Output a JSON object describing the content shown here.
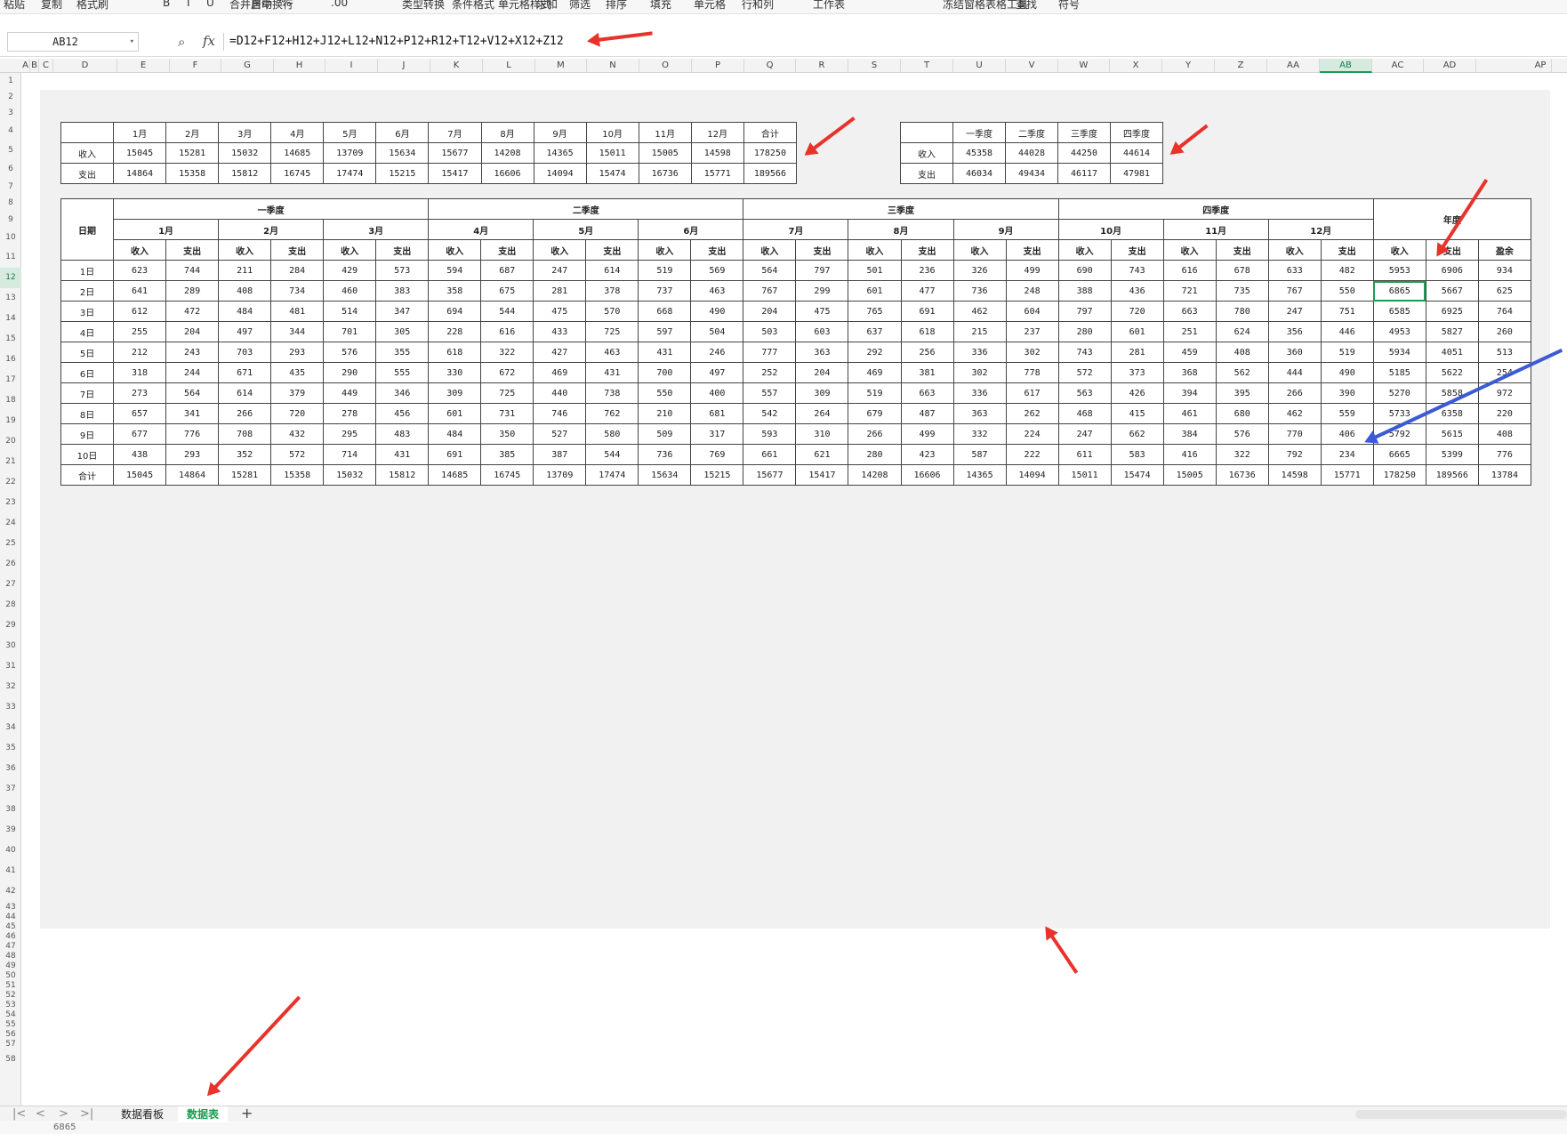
{
  "ribbon": [
    "粘贴",
    "复制",
    "格式刷",
    "B",
    "I",
    "U",
    "合并居中",
    "自动换行",
    "%",
    ".00",
    "类型转换",
    "条件格式",
    "单元格样式",
    "求和",
    "筛选",
    "排序",
    "填充",
    "单元格",
    "行和列",
    "工作表",
    "冻结窗格",
    "表格工具",
    "查找",
    "符号"
  ],
  "formula_bar": {
    "name_box": "AB12",
    "formula": "=D12+F12+H12+J12+L12+N12+P12+R12+T12+V12+X12+Z12",
    "zoom_icon": "zoom-icon",
    "fx_icon": "fx-icon"
  },
  "columns": [
    "A",
    "B",
    "C",
    "D",
    "E",
    "F",
    "G",
    "H",
    "I",
    "J",
    "K",
    "L",
    "M",
    "N",
    "O",
    "P",
    "Q",
    "R",
    "S",
    "T",
    "U",
    "V",
    "W",
    "X",
    "Y",
    "Z",
    "AA",
    "AB",
    "AC",
    "AD",
    "AP"
  ],
  "selected_column": "AB",
  "selected_row": "12",
  "rows": [
    "1",
    "2",
    "3",
    "4",
    "5",
    "6",
    "7",
    "8",
    "9",
    "10",
    "11",
    "12",
    "13",
    "14",
    "15",
    "16",
    "17",
    "18",
    "19",
    "20",
    "21",
    "22",
    "23",
    "24",
    "25",
    "26",
    "27",
    "28",
    "29",
    "30",
    "31",
    "32",
    "33",
    "34",
    "35",
    "36",
    "37",
    "38",
    "39",
    "40",
    "41",
    "42",
    "43",
    "44",
    "45",
    "46",
    "47",
    "48",
    "49",
    "50",
    "51",
    "52",
    "53",
    "54",
    "55",
    "56",
    "57",
    "58"
  ],
  "monthly_summary": {
    "headers": [
      "",
      "1月",
      "2月",
      "3月",
      "4月",
      "5月",
      "6月",
      "7月",
      "8月",
      "9月",
      "10月",
      "11月",
      "12月",
      "合计"
    ],
    "rows": [
      [
        "收入",
        "15045",
        "15281",
        "15032",
        "14685",
        "13709",
        "15634",
        "15677",
        "14208",
        "14365",
        "15011",
        "15005",
        "14598",
        "178250"
      ],
      [
        "支出",
        "14864",
        "15358",
        "15812",
        "16745",
        "17474",
        "15215",
        "15417",
        "16606",
        "14094",
        "15474",
        "16736",
        "15771",
        "189566"
      ]
    ]
  },
  "quarterly_summary": {
    "headers": [
      "",
      "一季度",
      "二季度",
      "三季度",
      "四季度"
    ],
    "rows": [
      [
        "收入",
        "45358",
        "44028",
        "44250",
        "44614"
      ],
      [
        "支出",
        "46034",
        "49434",
        "46117",
        "47981"
      ]
    ]
  },
  "main_table": {
    "date_header": "日期",
    "quarters": [
      "一季度",
      "二季度",
      "三季度",
      "四季度"
    ],
    "year_header": "年度",
    "months": [
      "1月",
      "2月",
      "3月",
      "4月",
      "5月",
      "6月",
      "7月",
      "8月",
      "9月",
      "10月",
      "11月",
      "12月"
    ],
    "income": "收入",
    "expense": "支出",
    "surplus": "盈余",
    "days": [
      [
        "1日",
        "623",
        "744",
        "211",
        "284",
        "429",
        "573",
        "594",
        "687",
        "247",
        "614",
        "519",
        "569",
        "564",
        "797",
        "501",
        "236",
        "326",
        "499",
        "690",
        "743",
        "616",
        "678",
        "633",
        "482",
        "5953",
        "6906",
        "934"
      ],
      [
        "2日",
        "641",
        "289",
        "408",
        "734",
        "460",
        "383",
        "358",
        "675",
        "281",
        "378",
        "737",
        "463",
        "767",
        "299",
        "601",
        "477",
        "736",
        "248",
        "388",
        "436",
        "721",
        "735",
        "767",
        "550",
        "6865",
        "5667",
        "625"
      ],
      [
        "3日",
        "612",
        "472",
        "484",
        "481",
        "514",
        "347",
        "694",
        "544",
        "475",
        "570",
        "668",
        "490",
        "204",
        "475",
        "765",
        "691",
        "462",
        "604",
        "797",
        "720",
        "663",
        "780",
        "247",
        "751",
        "6585",
        "6925",
        "764"
      ],
      [
        "4日",
        "255",
        "204",
        "497",
        "344",
        "701",
        "305",
        "228",
        "616",
        "433",
        "725",
        "597",
        "504",
        "503",
        "603",
        "637",
        "618",
        "215",
        "237",
        "280",
        "601",
        "251",
        "624",
        "356",
        "446",
        "4953",
        "5827",
        "260"
      ],
      [
        "5日",
        "212",
        "243",
        "703",
        "293",
        "576",
        "355",
        "618",
        "322",
        "427",
        "463",
        "431",
        "246",
        "777",
        "363",
        "292",
        "256",
        "336",
        "302",
        "743",
        "281",
        "459",
        "408",
        "360",
        "519",
        "5934",
        "4051",
        "513"
      ],
      [
        "6日",
        "318",
        "244",
        "671",
        "435",
        "290",
        "555",
        "330",
        "672",
        "469",
        "431",
        "700",
        "497",
        "252",
        "204",
        "469",
        "381",
        "302",
        "778",
        "572",
        "373",
        "368",
        "562",
        "444",
        "490",
        "5185",
        "5622",
        "254"
      ],
      [
        "7日",
        "273",
        "564",
        "614",
        "379",
        "449",
        "346",
        "309",
        "725",
        "440",
        "738",
        "550",
        "400",
        "557",
        "309",
        "519",
        "663",
        "336",
        "617",
        "563",
        "426",
        "394",
        "395",
        "266",
        "390",
        "5270",
        "5858",
        "972"
      ],
      [
        "8日",
        "657",
        "341",
        "266",
        "720",
        "278",
        "456",
        "601",
        "731",
        "746",
        "762",
        "210",
        "681",
        "542",
        "264",
        "679",
        "487",
        "363",
        "262",
        "468",
        "415",
        "461",
        "680",
        "462",
        "559",
        "5733",
        "6358",
        "220"
      ],
      [
        "9日",
        "677",
        "776",
        "708",
        "432",
        "295",
        "483",
        "484",
        "350",
        "527",
        "580",
        "509",
        "317",
        "593",
        "310",
        "266",
        "499",
        "332",
        "224",
        "247",
        "662",
        "384",
        "576",
        "770",
        "406",
        "5792",
        "5615",
        "408"
      ],
      [
        "10日",
        "438",
        "293",
        "352",
        "572",
        "714",
        "431",
        "691",
        "385",
        "387",
        "544",
        "736",
        "769",
        "661",
        "621",
        "280",
        "423",
        "587",
        "222",
        "611",
        "583",
        "416",
        "322",
        "792",
        "234",
        "6665",
        "5399",
        "776"
      ]
    ],
    "total": [
      "合计",
      "15045",
      "14864",
      "15281",
      "15358",
      "15032",
      "15812",
      "14685",
      "16745",
      "13709",
      "17474",
      "15634",
      "15215",
      "15677",
      "15417",
      "14208",
      "16606",
      "14365",
      "14094",
      "15011",
      "15474",
      "15005",
      "16736",
      "14598",
      "15771",
      "178250",
      "189566",
      "13784"
    ]
  },
  "sheet_tabs": [
    "数据看板",
    "数据表"
  ],
  "active_tab": "数据表",
  "status": {
    "partial": "6865"
  },
  "colors": {
    "accent": "#1e9b52",
    "arrow_red": "#e8332a",
    "arrow_blue": "#3b5bd6"
  }
}
